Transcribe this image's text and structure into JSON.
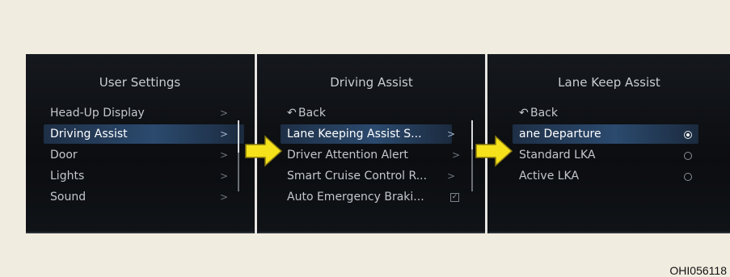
{
  "panels": {
    "user_settings": {
      "title": "User Settings",
      "items": [
        "Head-Up Display",
        "Driving Assist",
        "Door",
        "Lights",
        "Sound"
      ],
      "selected": "Driving Assist"
    },
    "driving_assist": {
      "title": "Driving Assist",
      "back": "Back",
      "items": [
        "Lane Keeping Assist S...",
        "Driver Attention Alert",
        "Smart Cruise Control R...",
        "Auto Emergency Braki..."
      ],
      "selected": "Lane Keeping Assist S..."
    },
    "lane_keep_assist": {
      "title": "Lane Keep Assist",
      "back": "Back",
      "items": [
        "ane Departure",
        "Standard LKA",
        "Active LKA"
      ],
      "selected": "ane Departure"
    }
  },
  "icons": {
    "chevron": "chevron-right-icon",
    "back": "back-arrow-icon",
    "flow_arrow": "yellow-arrow-icon",
    "radio": "radio-icon",
    "checkbox": "checkbox-icon"
  },
  "colors": {
    "arrow": "#f5e21b",
    "selection": "#2b4a6e",
    "background": "#f1ece0"
  },
  "caption": "OHI056118"
}
